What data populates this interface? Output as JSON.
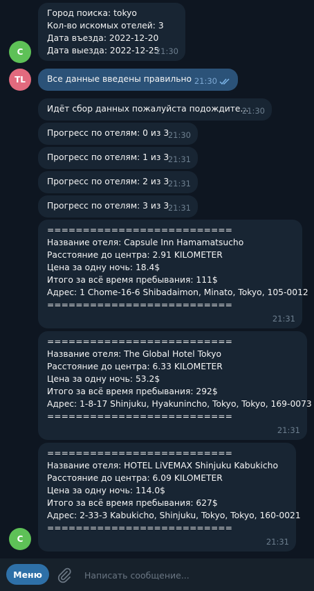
{
  "messages": [
    {
      "lines": [
        "Город поиска: tokyo",
        "Кол-во искомых отелей: 3",
        "Дата въезда: 2022-12-20",
        "Дата выезда: 2022-12-25"
      ],
      "time": "21:30"
    },
    {
      "lines": [
        "Все данные введены правильно"
      ],
      "time": "21:30"
    },
    {
      "lines": [
        "Идёт сбор данных пожалуйста подождите..."
      ],
      "time": "21:30"
    },
    {
      "lines": [
        "Прогресс по отелям: 0 из 3"
      ],
      "time": "21:30"
    },
    {
      "lines": [
        "Прогресс по отелям: 1 из 3"
      ],
      "time": "21:31"
    },
    {
      "lines": [
        "Прогресс по отелям: 2 из 3"
      ],
      "time": "21:31"
    },
    {
      "lines": [
        "Прогресс по отелям: 3 из 3"
      ],
      "time": "21:31"
    },
    {
      "lines": [
        "==========================",
        "",
        "Название отеля: Capsule Inn Hamamatsucho",
        "Расстояние до центра: 2.91 KILOMETER",
        "Цена за одну ночь: 18.4$",
        "Итого за всё время пребывания: 111$",
        "Адрес: 1 Chome-16-6 Shibadaimon, Minato, Tokyo, 105-0012",
        "=========================="
      ],
      "time": "21:31"
    },
    {
      "lines": [
        "==========================",
        "",
        "Название отеля: The Global Hotel Tokyo",
        "Расстояние до центра: 6.33 KILOMETER",
        "Цена за одну ночь: 53.2$",
        "Итого за всё время пребывания: 292$",
        "Адрес: 1-8-17 Shinjuku, Hyakunincho, Tokyo, Tokyo, 169-0073",
        "=========================="
      ],
      "time": "21:31"
    },
    {
      "lines": [
        "==========================",
        "",
        "Название отеля: HOTEL LiVEMAX Shinjuku Kabukicho",
        "Расстояние до центра: 6.09 KILOMETER",
        "Цена за одну ночь: 114.0$",
        "Итого за всё время пребывания: 627$",
        "Адрес: 2-33-3 Kabukicho, Shinjuku, Tokyo, Tokyo, 160-0021",
        "=========================="
      ],
      "time": "21:31"
    }
  ],
  "avatars": {
    "bot": "C",
    "user": "TL"
  },
  "colors": {
    "chat_bg": "#0e1621",
    "incoming": "#182533",
    "outgoing": "#2b5278",
    "menu_button": "#2e70a8",
    "bot_avatar": "#5ec157",
    "user_avatar": "#e26a7e"
  },
  "bottombar": {
    "menu_label": "Меню",
    "attach_icon": "paperclip-icon",
    "input_placeholder": "Написать сообщение..."
  }
}
